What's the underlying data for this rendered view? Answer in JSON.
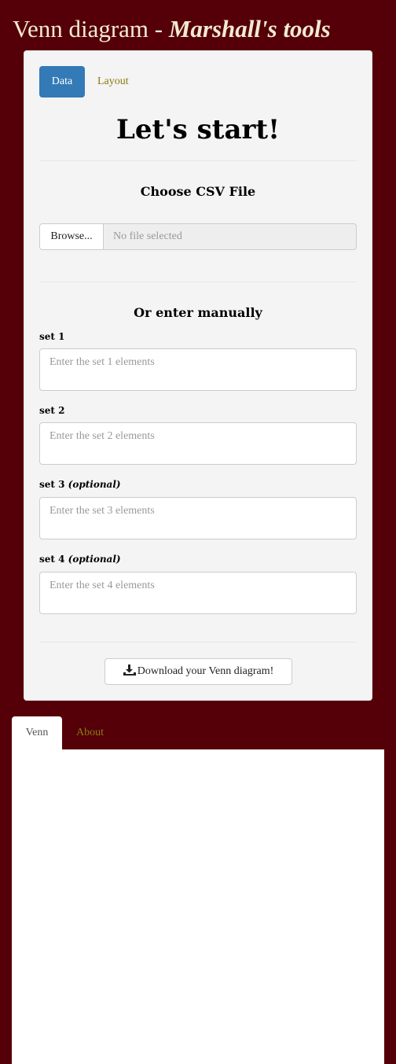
{
  "header": {
    "title_main": "Venn diagram - ",
    "title_sub": "Marshall's tools"
  },
  "sidebar": {
    "tabs": [
      {
        "label": "Data",
        "active": true
      },
      {
        "label": "Layout",
        "active": false
      }
    ],
    "heading": "Let's start!",
    "csv_section": {
      "title": "Choose CSV File",
      "browse_label": "Browse...",
      "file_status": "No file selected"
    },
    "manual_section": {
      "title": "Or enter manually",
      "sets": [
        {
          "label": "set 1",
          "optional_note": "",
          "placeholder": "Enter the set 1 elements",
          "value": ""
        },
        {
          "label": "set 2",
          "optional_note": "",
          "placeholder": "Enter the set 2 elements",
          "value": ""
        },
        {
          "label": "set 3",
          "optional_note": "(optional)",
          "placeholder": "Enter the set 3 elements",
          "value": ""
        },
        {
          "label": "set 4",
          "optional_note": "(optional)",
          "placeholder": "Enter the set 4 elements",
          "value": ""
        }
      ]
    },
    "download_label": "Download your Venn diagram!",
    "download_icon": "download-icon"
  },
  "main": {
    "tabs": [
      {
        "label": "Venn",
        "active": true
      },
      {
        "label": "About",
        "active": false
      }
    ]
  },
  "colors": {
    "background": "#550008",
    "title_text": "#f3ead2",
    "accent": "#337ab7",
    "link": "#8b7a12",
    "panel": "#f4f4f4"
  }
}
